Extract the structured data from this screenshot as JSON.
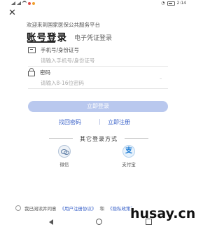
{
  "status_bar": {
    "time": "2:14"
  },
  "header": {
    "close_icon": "close-icon",
    "welcome": "欢迎来到国家医保公共服务平台",
    "tabs": [
      {
        "label": "账号登录",
        "active": true
      },
      {
        "label": "电子凭证登录",
        "active": false
      }
    ]
  },
  "form": {
    "account": {
      "label": "手机号/身份证号",
      "placeholder": "请输入手机号/身份证号",
      "icon": "id-card-icon"
    },
    "password": {
      "label": "密码",
      "placeholder": "请输入8-16位密码",
      "icon": "lock-icon"
    },
    "login_button": "立即登录",
    "forgot_link": "找回密码",
    "register_link": "立即注册"
  },
  "other_login": {
    "title": "其它登录方式",
    "options": [
      {
        "label": "微信",
        "icon": "wechat-icon"
      },
      {
        "label": "支付宝",
        "icon": "alipay-icon"
      }
    ]
  },
  "agreement": {
    "prefix": "我已阅读并同意",
    "user_agreement": "《用户注册协议》",
    "conjunction": "和",
    "privacy_policy": "《隐私政策》"
  },
  "watermark": "husay.cn",
  "colors": {
    "accent": "#3a62c9",
    "button": "#b9c8ee"
  }
}
